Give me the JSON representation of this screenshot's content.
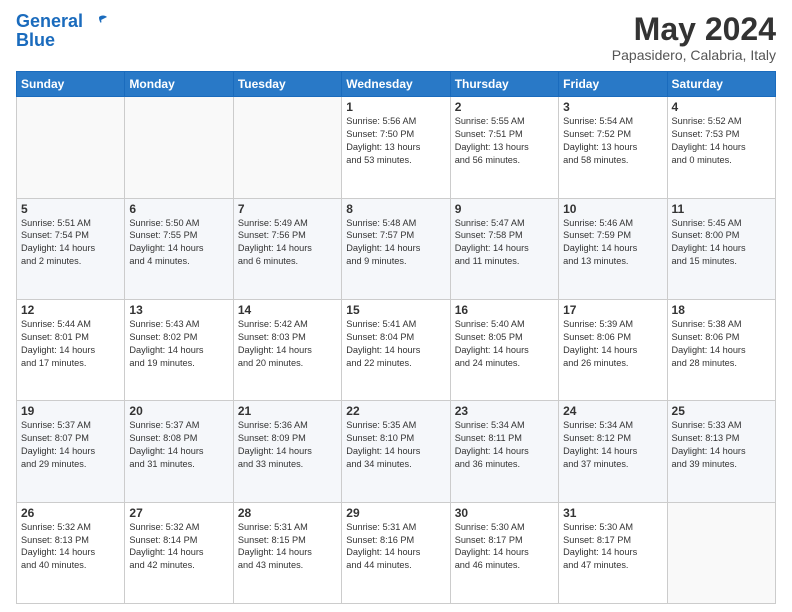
{
  "header": {
    "logo_line1": "General",
    "logo_line2": "Blue",
    "month": "May 2024",
    "location": "Papasidero, Calabria, Italy"
  },
  "weekdays": [
    "Sunday",
    "Monday",
    "Tuesday",
    "Wednesday",
    "Thursday",
    "Friday",
    "Saturday"
  ],
  "weeks": [
    [
      {
        "day": "",
        "info": ""
      },
      {
        "day": "",
        "info": ""
      },
      {
        "day": "",
        "info": ""
      },
      {
        "day": "1",
        "info": "Sunrise: 5:56 AM\nSunset: 7:50 PM\nDaylight: 13 hours\nand 53 minutes."
      },
      {
        "day": "2",
        "info": "Sunrise: 5:55 AM\nSunset: 7:51 PM\nDaylight: 13 hours\nand 56 minutes."
      },
      {
        "day": "3",
        "info": "Sunrise: 5:54 AM\nSunset: 7:52 PM\nDaylight: 13 hours\nand 58 minutes."
      },
      {
        "day": "4",
        "info": "Sunrise: 5:52 AM\nSunset: 7:53 PM\nDaylight: 14 hours\nand 0 minutes."
      }
    ],
    [
      {
        "day": "5",
        "info": "Sunrise: 5:51 AM\nSunset: 7:54 PM\nDaylight: 14 hours\nand 2 minutes."
      },
      {
        "day": "6",
        "info": "Sunrise: 5:50 AM\nSunset: 7:55 PM\nDaylight: 14 hours\nand 4 minutes."
      },
      {
        "day": "7",
        "info": "Sunrise: 5:49 AM\nSunset: 7:56 PM\nDaylight: 14 hours\nand 6 minutes."
      },
      {
        "day": "8",
        "info": "Sunrise: 5:48 AM\nSunset: 7:57 PM\nDaylight: 14 hours\nand 9 minutes."
      },
      {
        "day": "9",
        "info": "Sunrise: 5:47 AM\nSunset: 7:58 PM\nDaylight: 14 hours\nand 11 minutes."
      },
      {
        "day": "10",
        "info": "Sunrise: 5:46 AM\nSunset: 7:59 PM\nDaylight: 14 hours\nand 13 minutes."
      },
      {
        "day": "11",
        "info": "Sunrise: 5:45 AM\nSunset: 8:00 PM\nDaylight: 14 hours\nand 15 minutes."
      }
    ],
    [
      {
        "day": "12",
        "info": "Sunrise: 5:44 AM\nSunset: 8:01 PM\nDaylight: 14 hours\nand 17 minutes."
      },
      {
        "day": "13",
        "info": "Sunrise: 5:43 AM\nSunset: 8:02 PM\nDaylight: 14 hours\nand 19 minutes."
      },
      {
        "day": "14",
        "info": "Sunrise: 5:42 AM\nSunset: 8:03 PM\nDaylight: 14 hours\nand 20 minutes."
      },
      {
        "day": "15",
        "info": "Sunrise: 5:41 AM\nSunset: 8:04 PM\nDaylight: 14 hours\nand 22 minutes."
      },
      {
        "day": "16",
        "info": "Sunrise: 5:40 AM\nSunset: 8:05 PM\nDaylight: 14 hours\nand 24 minutes."
      },
      {
        "day": "17",
        "info": "Sunrise: 5:39 AM\nSunset: 8:06 PM\nDaylight: 14 hours\nand 26 minutes."
      },
      {
        "day": "18",
        "info": "Sunrise: 5:38 AM\nSunset: 8:06 PM\nDaylight: 14 hours\nand 28 minutes."
      }
    ],
    [
      {
        "day": "19",
        "info": "Sunrise: 5:37 AM\nSunset: 8:07 PM\nDaylight: 14 hours\nand 29 minutes."
      },
      {
        "day": "20",
        "info": "Sunrise: 5:37 AM\nSunset: 8:08 PM\nDaylight: 14 hours\nand 31 minutes."
      },
      {
        "day": "21",
        "info": "Sunrise: 5:36 AM\nSunset: 8:09 PM\nDaylight: 14 hours\nand 33 minutes."
      },
      {
        "day": "22",
        "info": "Sunrise: 5:35 AM\nSunset: 8:10 PM\nDaylight: 14 hours\nand 34 minutes."
      },
      {
        "day": "23",
        "info": "Sunrise: 5:34 AM\nSunset: 8:11 PM\nDaylight: 14 hours\nand 36 minutes."
      },
      {
        "day": "24",
        "info": "Sunrise: 5:34 AM\nSunset: 8:12 PM\nDaylight: 14 hours\nand 37 minutes."
      },
      {
        "day": "25",
        "info": "Sunrise: 5:33 AM\nSunset: 8:13 PM\nDaylight: 14 hours\nand 39 minutes."
      }
    ],
    [
      {
        "day": "26",
        "info": "Sunrise: 5:32 AM\nSunset: 8:13 PM\nDaylight: 14 hours\nand 40 minutes."
      },
      {
        "day": "27",
        "info": "Sunrise: 5:32 AM\nSunset: 8:14 PM\nDaylight: 14 hours\nand 42 minutes."
      },
      {
        "day": "28",
        "info": "Sunrise: 5:31 AM\nSunset: 8:15 PM\nDaylight: 14 hours\nand 43 minutes."
      },
      {
        "day": "29",
        "info": "Sunrise: 5:31 AM\nSunset: 8:16 PM\nDaylight: 14 hours\nand 44 minutes."
      },
      {
        "day": "30",
        "info": "Sunrise: 5:30 AM\nSunset: 8:17 PM\nDaylight: 14 hours\nand 46 minutes."
      },
      {
        "day": "31",
        "info": "Sunrise: 5:30 AM\nSunset: 8:17 PM\nDaylight: 14 hours\nand 47 minutes."
      },
      {
        "day": "",
        "info": ""
      }
    ]
  ]
}
